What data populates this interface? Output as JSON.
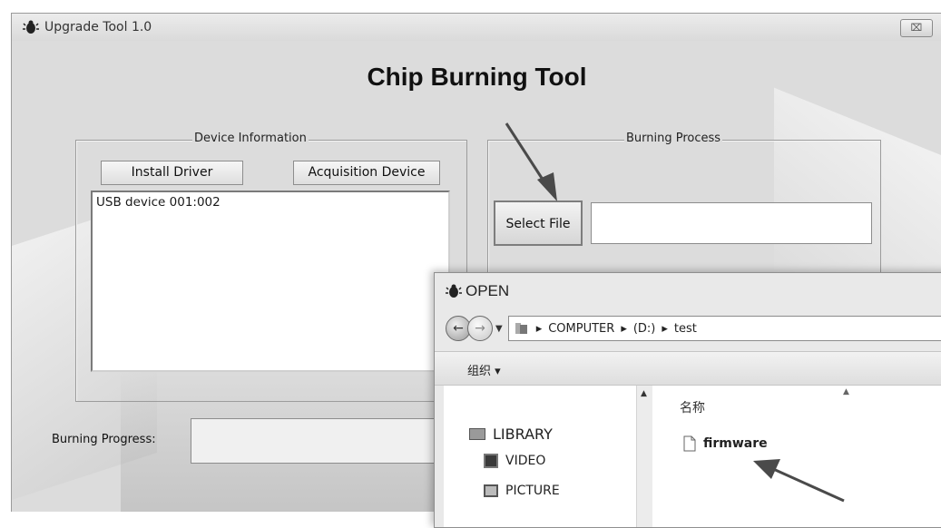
{
  "window": {
    "title": "Upgrade Tool 1.0",
    "close_glyph": "⌧",
    "heading": "Chip Burning Tool"
  },
  "device_info": {
    "group_title": "Device Information",
    "install_driver_label": "Install Driver",
    "acquisition_device_label": "Acquisition Device",
    "devices": [
      "USB device 001:002"
    ]
  },
  "burning_process": {
    "group_title": "Burning Process",
    "select_file_label": "Select File",
    "file_path_value": ""
  },
  "progress": {
    "label": "Burning Progress:",
    "value": ""
  },
  "open_dialog": {
    "title": "OPEN",
    "back_glyph": "←",
    "forward_glyph": "→",
    "breadcrumb": [
      "COMPUTER",
      "(D:)",
      "test"
    ],
    "organize_label": "组织 ▾",
    "name_column_header": "名称",
    "nav_items": {
      "library": "LIBRARY",
      "video": "VIDEO",
      "picture": "PICTURE"
    },
    "files": [
      "firmware"
    ]
  },
  "colors": {
    "window_bg": "#dcdcdc",
    "arrow": "#4a4a4a"
  }
}
